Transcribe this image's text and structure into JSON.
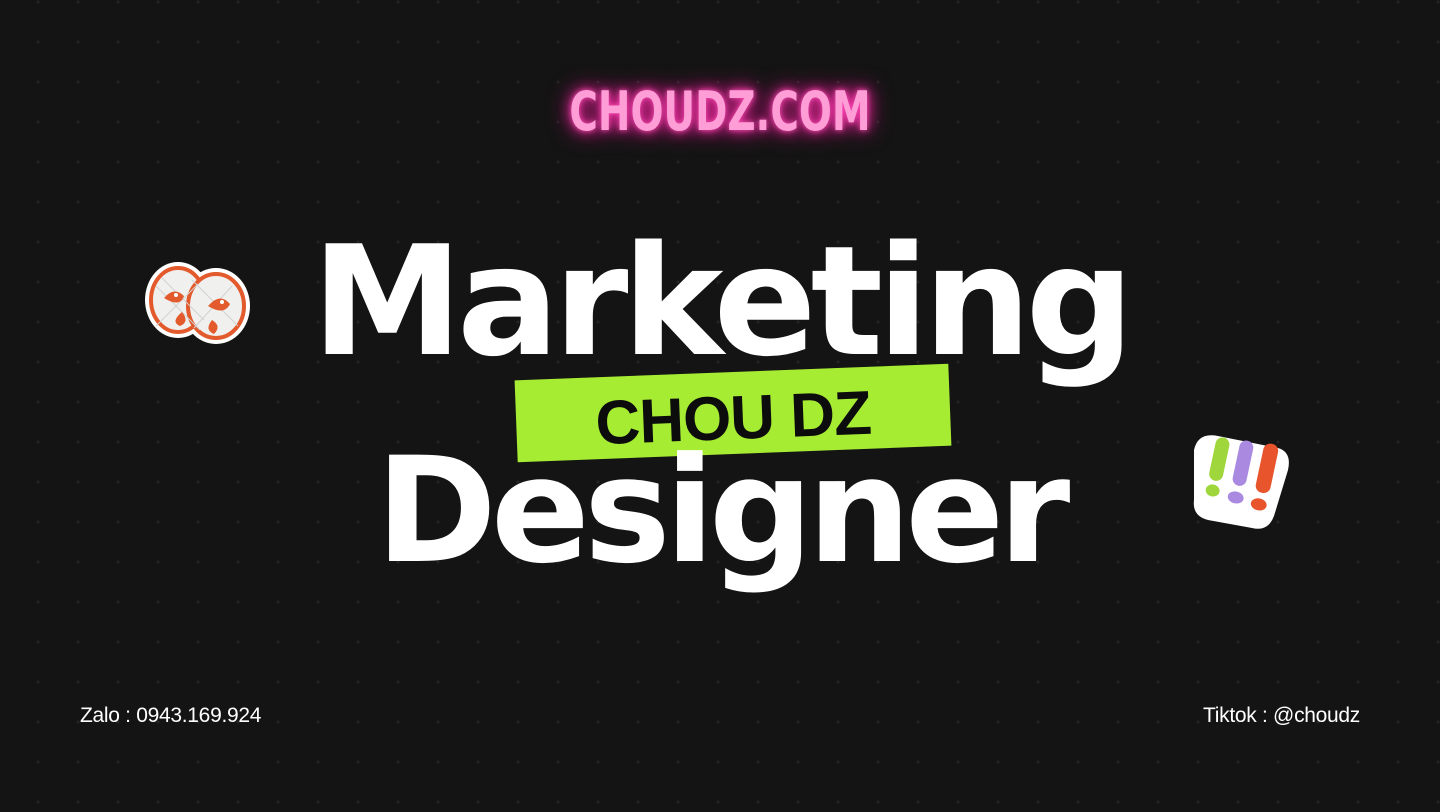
{
  "brand": {
    "text": "CHOUDZ.COM",
    "color": "#ff9ed6"
  },
  "headline": {
    "line1": "Marketing",
    "line2": "Designer"
  },
  "tag": {
    "text": "CHOU DZ",
    "color": "#a6ec33"
  },
  "footer": {
    "left": "Zalo : 0943.169.924",
    "right": "Tiktok : @choudz"
  },
  "stickers": {
    "left_icon": "twin-birds-sticker-icon",
    "right_icon": "exclamation-marks-sticker-icon"
  },
  "colors": {
    "background": "#141414",
    "headline": "#ffffff"
  }
}
